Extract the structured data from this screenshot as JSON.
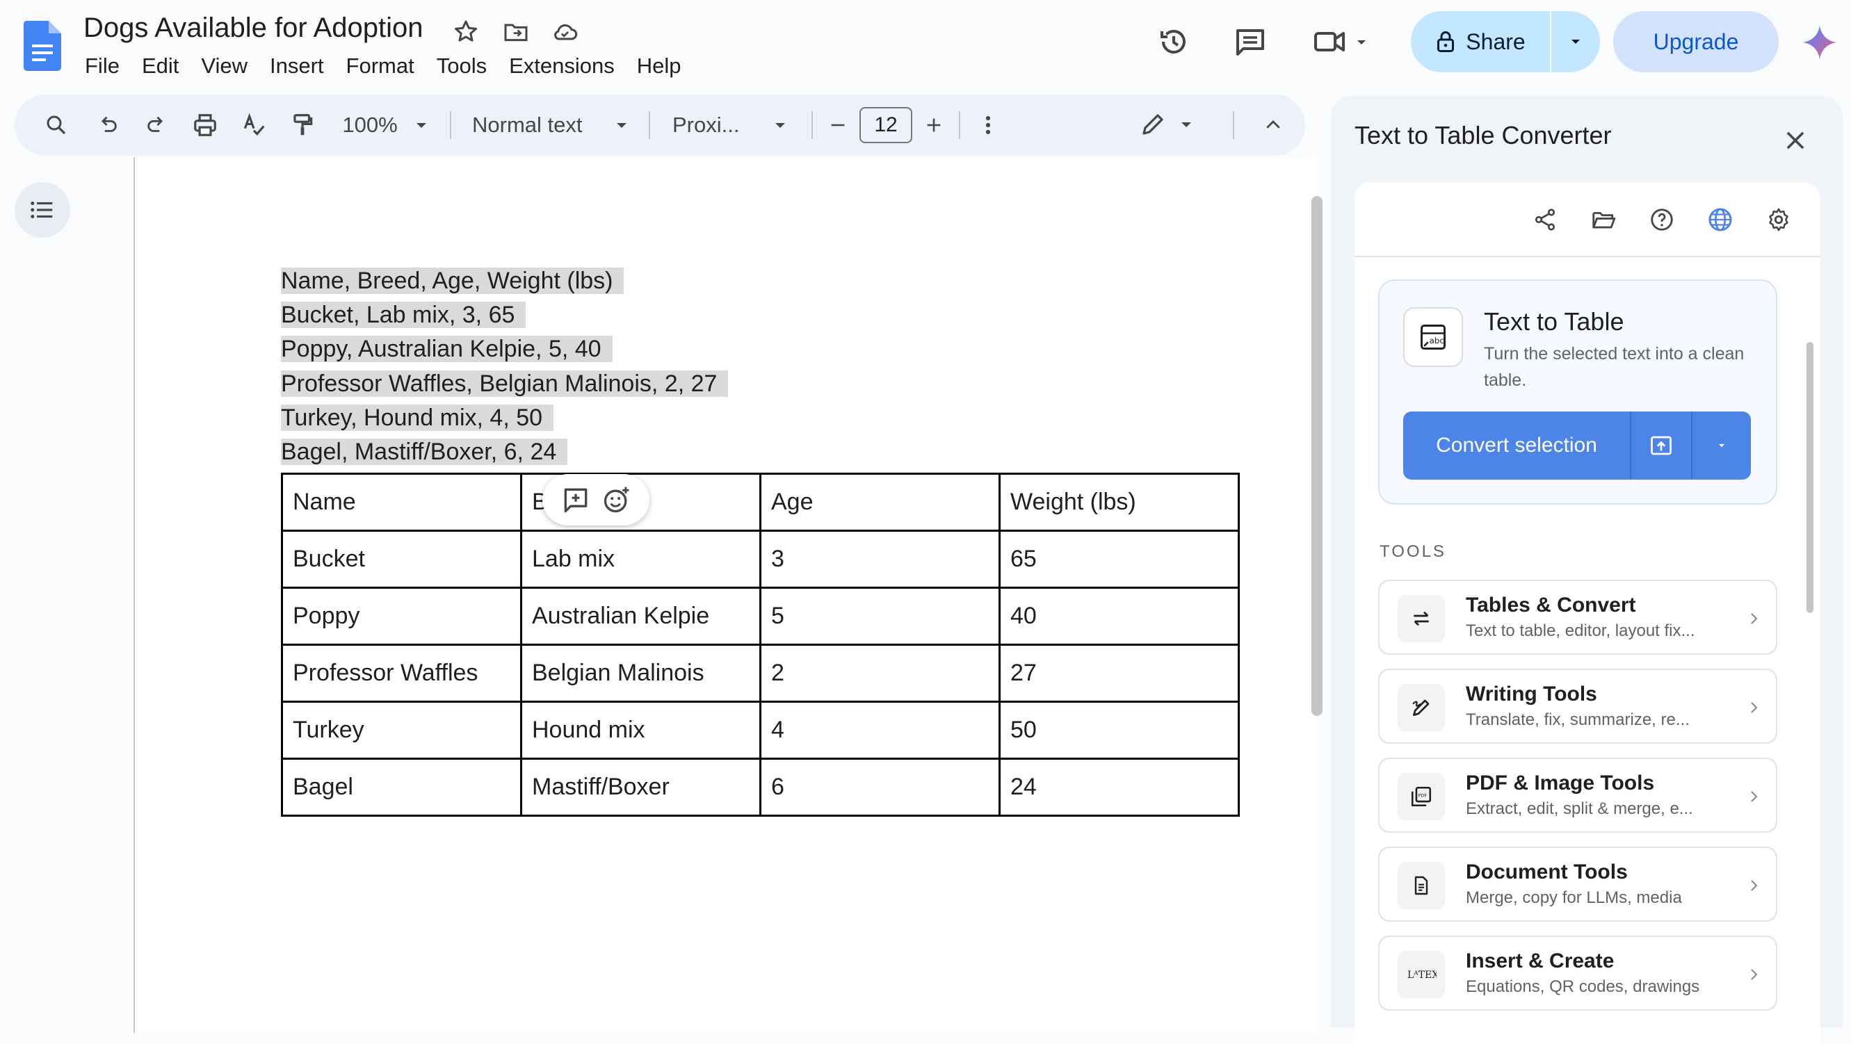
{
  "app": {
    "doc_title": "Dogs Available for Adoption",
    "menu": [
      "File",
      "Edit",
      "View",
      "Insert",
      "Format",
      "Tools",
      "Extensions",
      "Help"
    ]
  },
  "header": {
    "share_label": "Share",
    "upgrade_label": "Upgrade"
  },
  "toolbar": {
    "zoom": "100%",
    "style": "Normal text",
    "font": "Proxi...",
    "font_size": "12"
  },
  "document": {
    "lines": [
      "Name, Breed, Age, Weight (lbs)",
      "Bucket, Lab mix, 3, 65",
      "Poppy, Australian Kelpie, 5, 40",
      "Professor Waffles, Belgian Malinois, 2, 27",
      "Turkey, Hound mix, 4, 50",
      "Bagel, Mastiff/Boxer, 6, 24"
    ],
    "table": {
      "header": [
        "Name",
        "Breed",
        "Age",
        "Weight (lbs)"
      ],
      "rows": [
        [
          "Bucket",
          "Lab mix",
          "3",
          "65"
        ],
        [
          "Poppy",
          "Australian Kelpie",
          "5",
          "40"
        ],
        [
          "Professor Waffles",
          "Belgian Malinois",
          "2",
          "27"
        ],
        [
          "Turkey",
          "Hound mix",
          "4",
          "50"
        ],
        [
          "Bagel",
          "Mastiff/Boxer",
          "6",
          "24"
        ]
      ]
    }
  },
  "panel": {
    "title": "Text to Table Converter",
    "hero": {
      "title": "Text to Table",
      "description": "Turn the selected text into a clean table.",
      "convert_label": "Convert selection"
    },
    "tools_heading": "TOOLS",
    "tools": [
      {
        "title": "Tables & Convert",
        "desc": "Text to table, editor, layout fix..."
      },
      {
        "title": "Writing Tools",
        "desc": "Translate, fix, summarize, re..."
      },
      {
        "title": "PDF & Image Tools",
        "desc": "Extract, edit, split & merge, e..."
      },
      {
        "title": "Document Tools",
        "desc": "Merge, copy for LLMs, media"
      },
      {
        "title": "Insert & Create",
        "desc": "Equations, QR codes, drawings"
      }
    ]
  },
  "colors": {
    "accent": "#4d84e8",
    "share_bg": "#c2e7ff",
    "selection_highlight": "#dadada"
  }
}
